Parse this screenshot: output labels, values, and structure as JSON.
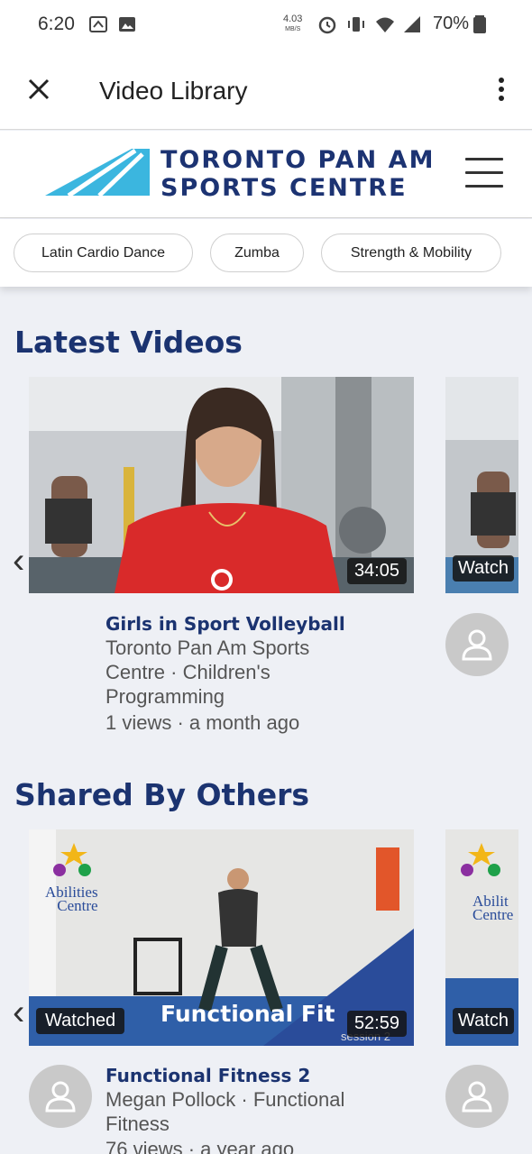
{
  "status_bar": {
    "time": "6:20",
    "speed_value": "4.03",
    "speed_unit": "MB/S",
    "battery": "70%"
  },
  "app_bar": {
    "title": "Video Library"
  },
  "brand": {
    "line1": "TORONTO PAN AM",
    "line2": "SPORTS CENTRE",
    "colors": {
      "navy": "#1c3372",
      "cyan": "#3bb6df"
    }
  },
  "chips": [
    "Latin Cardio Dance",
    "Zumba",
    "Strength & Mobility"
  ],
  "latest": {
    "heading": "Latest Videos",
    "video": {
      "duration": "34:05",
      "title": "Girls in Sport Volleyball",
      "meta_lines": [
        "Toronto Pan Am Sports",
        "Centre · Children's",
        "Programming"
      ],
      "stats": "1 views · a month ago"
    },
    "peek_label": "Watch"
  },
  "shared": {
    "heading": "Shared By Others",
    "video": {
      "watched_label": "Watched",
      "overlay_title": "Functional Fit",
      "overlay_sub": "session 2",
      "duration": "52:59",
      "title": "Functional Fitness 2",
      "meta_lines": [
        "Megan Pollock · Functional",
        "Fitness"
      ],
      "stats": "76 views · a year ago",
      "logo_line1": "Abilities",
      "logo_line2": "Centre"
    },
    "peek_label": "Watch",
    "peek_logo_line1": "Abilit",
    "peek_logo_line2": "Centre"
  }
}
